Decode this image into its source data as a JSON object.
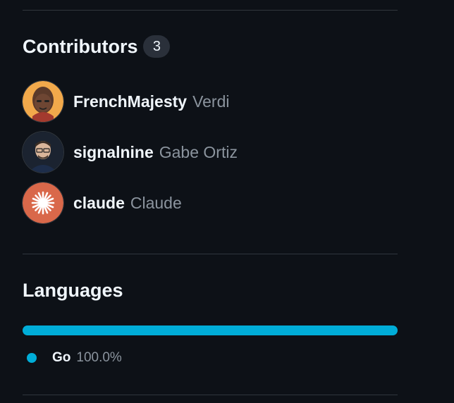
{
  "contributors": {
    "title": "Contributors",
    "count": "3",
    "items": [
      {
        "login": "FrenchMajesty",
        "name": "Verdi"
      },
      {
        "login": "signalnine",
        "name": "Gabe Ortiz"
      },
      {
        "login": "claude",
        "name": "Claude"
      }
    ]
  },
  "languages": {
    "title": "Languages",
    "items": [
      {
        "name": "Go",
        "percent": "100.0%",
        "fraction": 1.0,
        "color": "#00add8"
      }
    ]
  }
}
